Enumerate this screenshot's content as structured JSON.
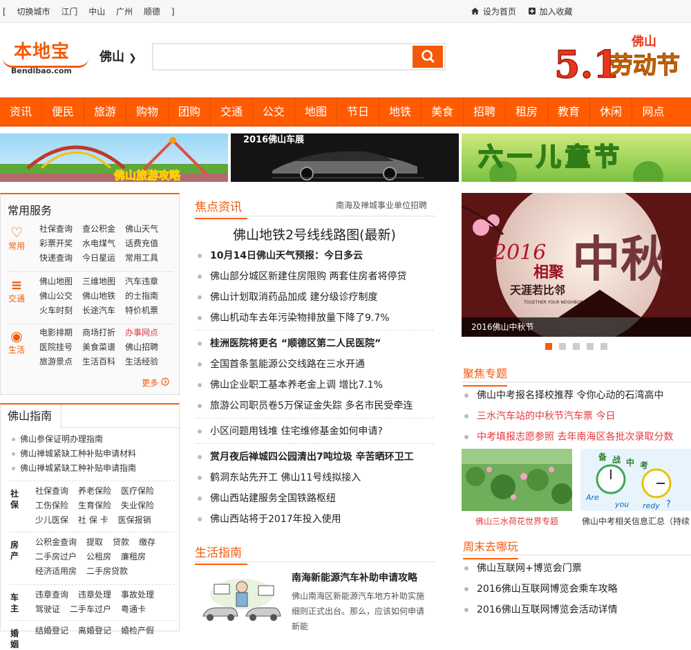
{
  "topbar": {
    "cities": [
      "[",
      "切换城市",
      "江门",
      "中山",
      "广州",
      "顺德",
      "]"
    ],
    "set_home": "设为首页",
    "add_fav": "加入收藏"
  },
  "header": {
    "logo_cn": "本地宝",
    "logo_en": "Bendibao.com",
    "city": "佛山",
    "banner_text_1": "5.1",
    "banner_text_2": "劳动节",
    "banner_text_3": "佛山"
  },
  "nav": [
    "资讯",
    "便民",
    "旅游",
    "购物",
    "团购",
    "交通",
    "公交",
    "地图",
    "节日",
    "地铁",
    "美食",
    "招聘",
    "租房",
    "教育",
    "休闲",
    "网点"
  ],
  "ads": {
    "ad1": "佛山旅游攻略",
    "ad2": "2016佛山车展",
    "ad3": "六一儿童节"
  },
  "services": {
    "title": "常用服务",
    "groups": [
      {
        "label": "常用",
        "icon": "heart-icon",
        "items": [
          "社保查询",
          "查公积金",
          "佛山天气",
          "彩票开奖",
          "水电煤气",
          "话费充值",
          "快递查询",
          "今日星运",
          "常用工具"
        ]
      },
      {
        "label": "交通",
        "icon": "traffic-light-icon",
        "items": [
          "佛山地图",
          "三维地图",
          "汽车违章",
          "佛山公交",
          "佛山地铁",
          "的士指南",
          "火车时刻",
          "长途汽车",
          "特价机票"
        ]
      },
      {
        "label": "生活",
        "icon": "life-ring-icon",
        "items": [
          "电影排期",
          "商场打折",
          "办事网点",
          "医院挂号",
          "美食菜谱",
          "佛山招聘",
          "旅游景点",
          "生活百科",
          "生活经验"
        ]
      }
    ],
    "more": "更多"
  },
  "guide": {
    "title": "佛山指南",
    "list": [
      "佛山参保证明办理指南",
      "佛山禅城紧缺工种补贴申请材料",
      "佛山禅城紧缺工种补贴申请指南"
    ],
    "sections": [
      {
        "label": "社保",
        "items": [
          "社保查询",
          "养老保险",
          "医疗保险",
          "工伤保险",
          "生育保险",
          "失业保险",
          "少儿医保",
          "社 保 卡",
          "医保报销"
        ]
      },
      {
        "label": "房产",
        "items": [
          "公积金查询",
          "提取",
          "贷款",
          "缴存",
          "二手房过户",
          "公租房",
          "廉租房",
          "经济适用房",
          "二手房贷款"
        ]
      },
      {
        "label": "车主",
        "items": [
          "违章查询",
          "违章处理",
          "事故处理",
          "驾驶证",
          "二手车过户",
          "粤通卡"
        ]
      },
      {
        "label": "婚姻",
        "items": [
          "结婚登记",
          "离婚登记",
          "婚检产假"
        ]
      }
    ]
  },
  "focus": {
    "title": "焦点资讯",
    "right_link": "南海及禅城事业单位招聘",
    "headline": "佛山地铁2号线线路图(最新)",
    "groups": [
      [
        {
          "text": "10月14日佛山天气预报：今日多云",
          "bold": true
        },
        {
          "text": "佛山部分城区新建住房限购 两套住房者将停贷",
          "bold": false
        },
        {
          "text": "佛山计划取消药品加成 建分级诊疗制度",
          "bold": false
        },
        {
          "text": "佛山机动车去年污染物排放量下降了9.7%",
          "bold": false
        }
      ],
      [
        {
          "text": "桂洲医院将更名 “顺德区第二人民医院”",
          "bold": true
        },
        {
          "text": "全国首条氢能源公交线路在三水开通",
          "bold": false
        },
        {
          "text": "佛山企业职工基本养老金上调 增比7.1%",
          "bold": false
        },
        {
          "text": "旅游公司职员卷5万保证金失踪 多名市民受牵连",
          "bold": false
        }
      ],
      [
        {
          "text": "小区问题用钱堆 住宅维修基金如何申请?",
          "bold": false
        }
      ],
      [
        {
          "text": "赏月夜后禅城四公园清出7吨垃圾 辛苦晒环卫工",
          "bold": true
        },
        {
          "text": "鹤洞东站先开工 佛山11号线拟接入",
          "bold": false
        },
        {
          "text": "佛山西站建服务全国铁路枢纽",
          "bold": false
        },
        {
          "text": "佛山西站将于2017年投入使用",
          "bold": false
        }
      ]
    ]
  },
  "life": {
    "title": "生活指南",
    "item_title": "南海新能源汽车补助申请攻略",
    "item_desc": "佛山南海区新能源汽车地方补助实施细则正式出台。那么，应该如何申请新能"
  },
  "slide": {
    "caption": "2016佛山中秋节",
    "year": "2016",
    "big_text": "中秋",
    "line1": "相聚",
    "line2": "天涯若比邻",
    "line3": "TOGETHER YOUR NEIGHBOR",
    "dots": 5,
    "active": 0
  },
  "topics": {
    "title": "聚焦专题",
    "items": [
      {
        "text": "佛山中考报名择校推荐 令你心动的石湾高中",
        "red": false
      },
      {
        "text": "三水汽车站的中秋节汽车票 今日",
        "red": true
      },
      {
        "text": "中考填报志愿参照 去年南海区各批次录取分数",
        "red": true
      }
    ],
    "pic1_caption": "佛山三水荷花世界专题",
    "pic2_caption": "佛山中考相关信息汇总（持续",
    "pic2_text": [
      "备",
      "战",
      "中",
      "考",
      "Are",
      "you",
      "redy",
      "?"
    ]
  },
  "weekend": {
    "title": "周末去哪玩",
    "items": [
      "佛山互联网+博览会门票",
      "2016佛山互联网博览会乘车攻略",
      "2016佛山互联网博览会活动详情"
    ]
  }
}
